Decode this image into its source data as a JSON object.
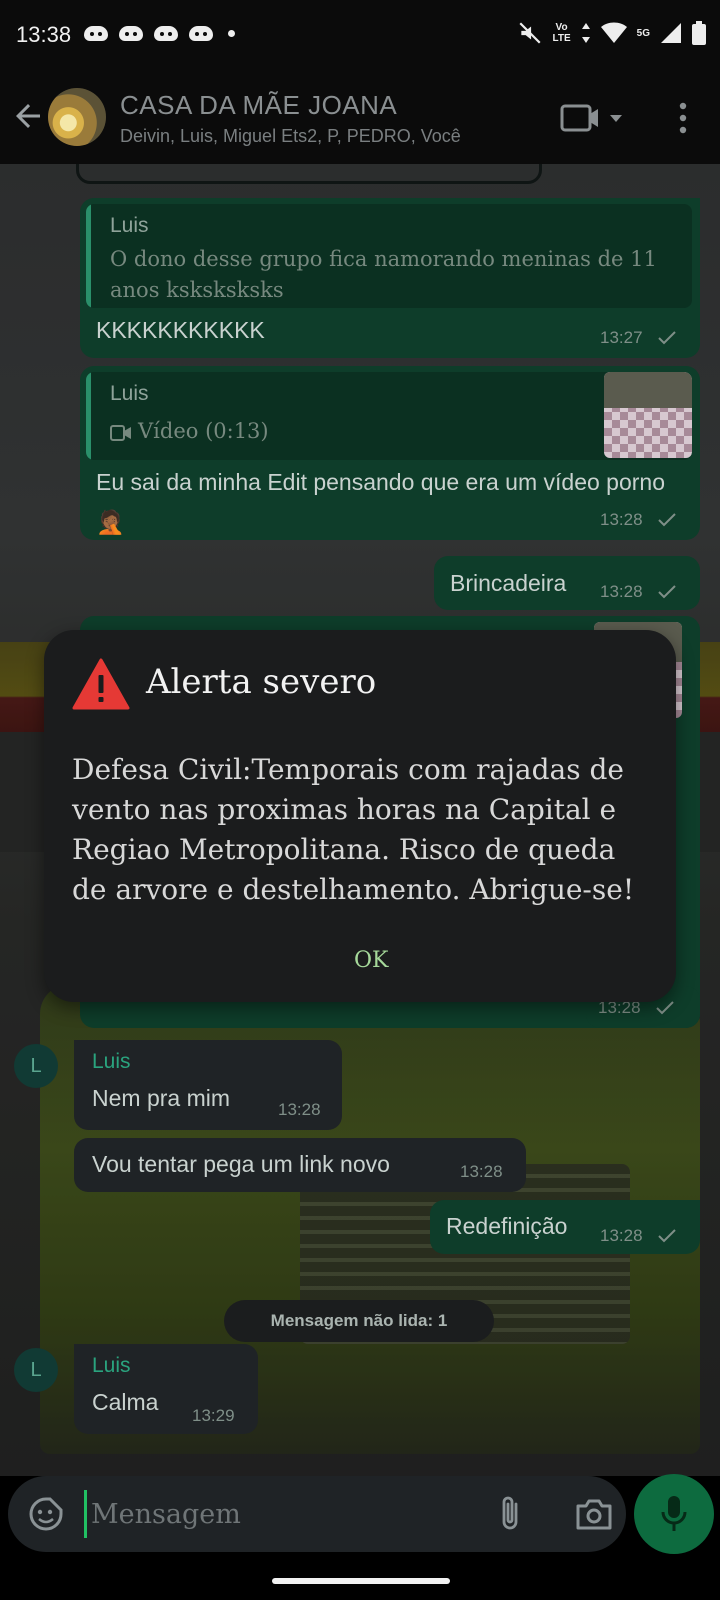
{
  "status_bar": {
    "time": "13:38",
    "notification_icons": [
      "discord-icon",
      "discord-icon",
      "discord-icon",
      "discord-icon"
    ],
    "network_label_top": "Vo",
    "network_label_bottom": "LTE",
    "fiveg_label": "5G",
    "icons": [
      "mute-icon",
      "data-arrows-icon",
      "wifi-icon",
      "signal-icon",
      "battery-icon"
    ]
  },
  "header": {
    "title": "CASA DA MÃE JOANA",
    "members": "Deivin, Luis, Miguel Ets2, P, PEDRO, Você"
  },
  "messages": [
    {
      "quote_name": "Luis",
      "quote_text": "O dono desse grupo fica namorando meninas de 11 anos ksksksksks",
      "text": "KKKKKKKKKKK",
      "time": "13:27"
    },
    {
      "quote_name": "Luis",
      "quote_text": "Vídeo (0:13)",
      "text": "Eu sai da minha Edit pensando que era um vídeo porno 🤦🏾",
      "time": "13:28"
    },
    {
      "text": "Brincadeira",
      "time": "13:28"
    },
    {
      "time": "13:28"
    },
    {
      "sender": "Luis",
      "text": "Nem pra mim",
      "time": "13:28"
    },
    {
      "text": "Vou tentar pega um link novo",
      "time": "13:28"
    },
    {
      "text": "Redefinição",
      "time": "13:28"
    },
    {
      "sender": "Luis",
      "text": "Calma",
      "time": "13:29"
    }
  ],
  "avatar_initial": "L",
  "unread_label": "Mensagem não lida: 1",
  "input": {
    "placeholder": "Mensagem"
  },
  "alert": {
    "title": "Alerta severo",
    "body": "Defesa Civil:Temporais com rajadas de vento nas proximas horas na Capital e Regiao Metropolitana. Risco de queda de arvore e destelhamento. Abrigue-se!",
    "ok": "OK"
  },
  "colors": {
    "outgoing_bubble": "#0e3d2a",
    "incoming_bubble": "#1f2326",
    "accent_green": "#21c063",
    "alert_red": "#e53935",
    "sender_green": "#2aa37e"
  }
}
